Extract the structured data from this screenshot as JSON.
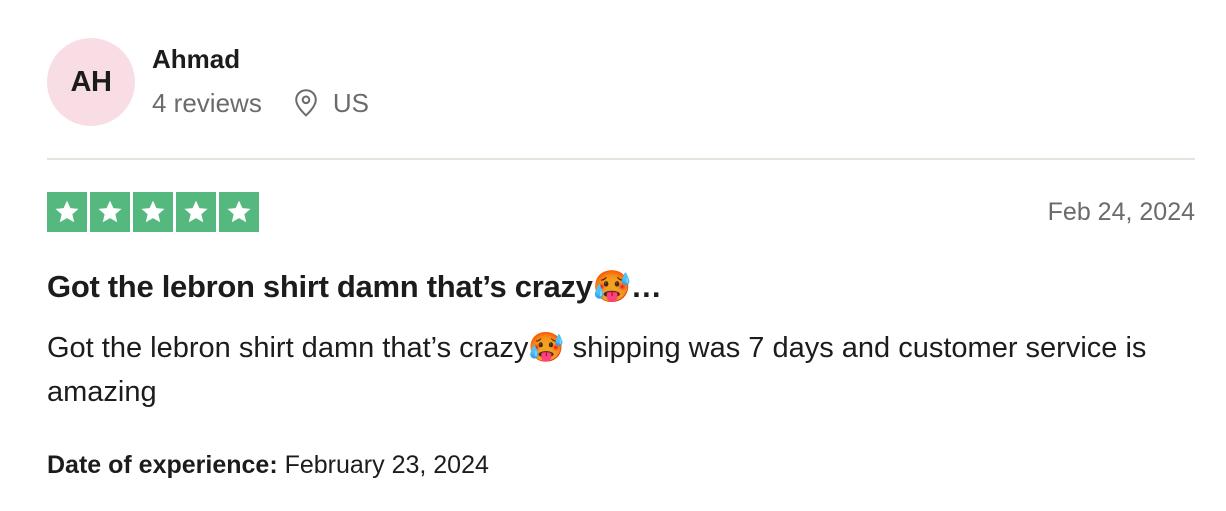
{
  "reviewer": {
    "initials": "AH",
    "name": "Ahmad",
    "reviews_count": "4 reviews",
    "location": "US",
    "avatar_color": "#f8dee4"
  },
  "review": {
    "rating": 5,
    "max_rating": 5,
    "star_color": "#55b97f",
    "date": "Feb 24, 2024",
    "title": "Got the lebron shirt damn that’s crazy🥵…",
    "body": "Got the lebron shirt damn that’s crazy🥵 shipping was 7 days and customer service is amazing",
    "experience_label": "Date of experience:",
    "experience_date": "February 23, 2024"
  },
  "icons": {
    "location": "location-pin-icon",
    "star": "star-icon"
  }
}
